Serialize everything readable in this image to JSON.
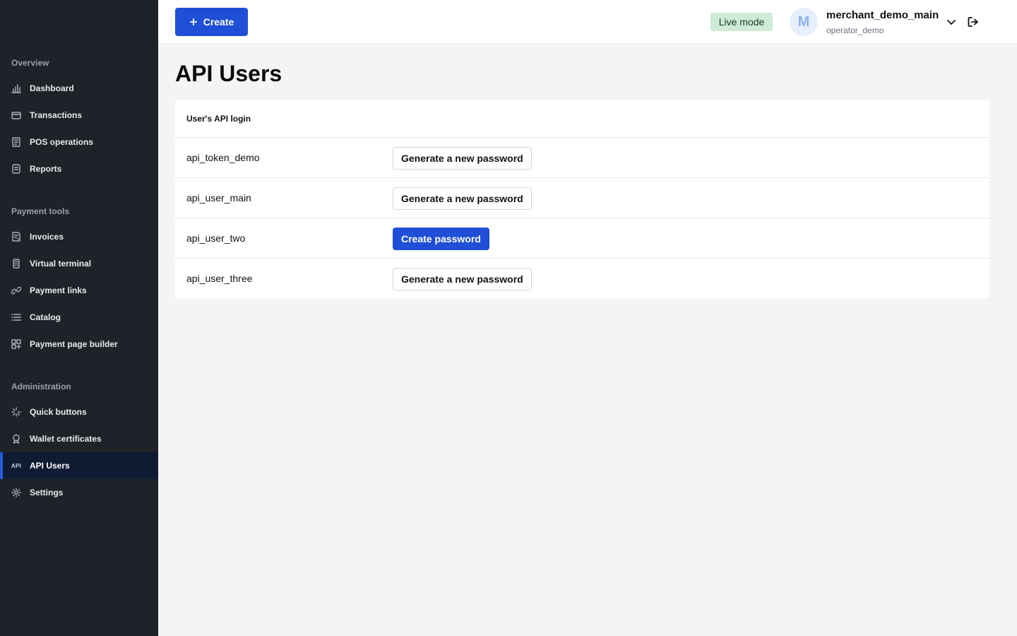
{
  "sidebar": {
    "sections": [
      {
        "label": "Overview",
        "items": [
          {
            "label": "Dashboard",
            "icon": "bar-chart-icon"
          },
          {
            "label": "Transactions",
            "icon": "wallet-icon"
          },
          {
            "label": "POS operations",
            "icon": "receipt-icon"
          },
          {
            "label": "Reports",
            "icon": "document-icon"
          }
        ]
      },
      {
        "label": "Payment tools",
        "items": [
          {
            "label": "Invoices",
            "icon": "invoice-icon"
          },
          {
            "label": "Virtual terminal",
            "icon": "terminal-icon"
          },
          {
            "label": "Payment links",
            "icon": "link-icon"
          },
          {
            "label": "Catalog",
            "icon": "list-icon"
          },
          {
            "label": "Payment page builder",
            "icon": "grid-plus-icon"
          }
        ]
      },
      {
        "label": "Administration",
        "items": [
          {
            "label": "Quick buttons",
            "icon": "quick-action-icon"
          },
          {
            "label": "Wallet certificates",
            "icon": "certificate-icon"
          },
          {
            "label": "API Users",
            "icon": "api-icon",
            "icon_text": "API",
            "active": true
          },
          {
            "label": "Settings",
            "icon": "gear-icon"
          }
        ]
      }
    ]
  },
  "topbar": {
    "create_label": "Create",
    "mode_badge": "Live mode",
    "avatar_letter": "M",
    "account_name": "merchant_demo_main",
    "account_sub": "operator_demo"
  },
  "page": {
    "title": "API Users",
    "column_header": "User's API login",
    "rows": [
      {
        "login": "api_token_demo",
        "action": "Generate a new password",
        "style": "secondary"
      },
      {
        "login": "api_user_main",
        "action": "Generate a new password",
        "style": "secondary"
      },
      {
        "login": "api_user_two",
        "action": "Create password",
        "style": "primary"
      },
      {
        "login": "api_user_three",
        "action": "Generate a new password",
        "style": "secondary"
      }
    ]
  },
  "colors": {
    "sidebar_bg": "#1f2329",
    "accent": "#1f4fd6",
    "live_badge_bg": "#cdebd6",
    "active_nav_bg": "#0f1a33"
  }
}
